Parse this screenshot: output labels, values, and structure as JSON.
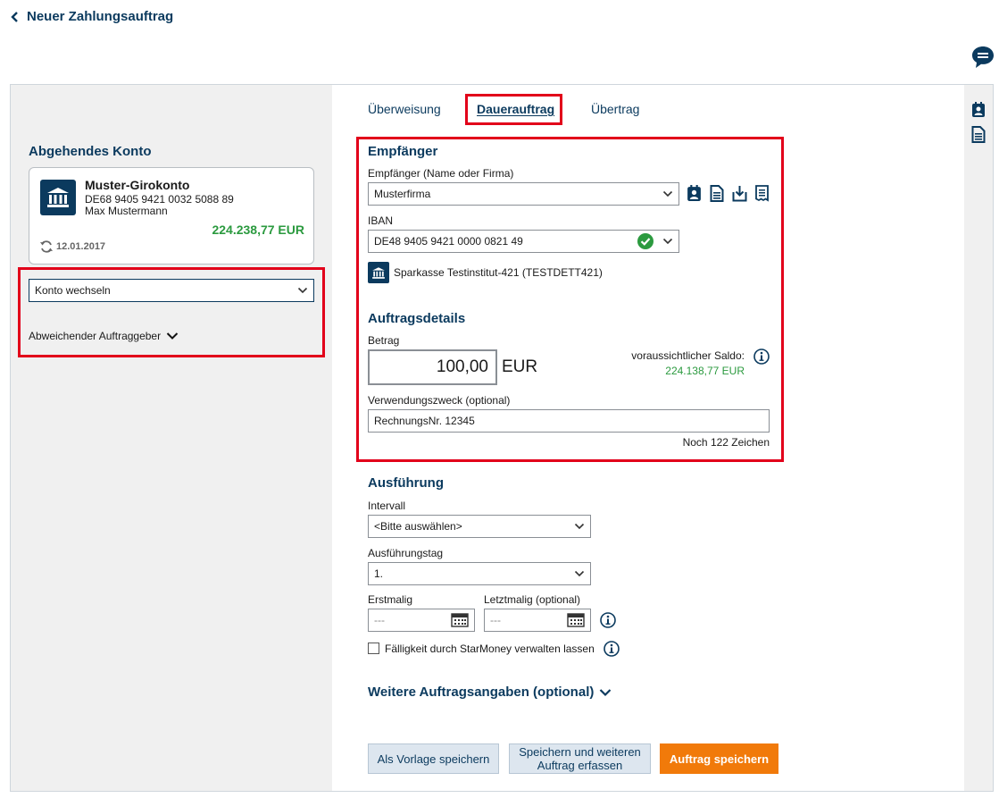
{
  "header": {
    "title": "Neuer Zahlungsauftrag"
  },
  "tabs": [
    {
      "label": "Überweisung"
    },
    {
      "label": "Dauerauftrag"
    },
    {
      "label": "Übertrag"
    }
  ],
  "source_account": {
    "heading": "Abgehendes Konto",
    "name": "Muster-Girokonto",
    "iban": "DE68 9405 9421 0032 5088 89",
    "owner": "Max Mustermann",
    "balance": "224.238,77 EUR",
    "updated": "12.01.2017",
    "switch_label": "Konto wechseln",
    "different_payer_label": "Abweichender Auftraggeber"
  },
  "recipient": {
    "heading": "Empfänger",
    "name_label": "Empfänger (Name oder Firma)",
    "name_value": "Musterfirma",
    "iban_label": "IBAN",
    "iban_value": "DE48 9405 9421 0000 0821 49",
    "bank_name": "Sparkasse Testinstitut-421",
    "bic": "(TESTDETT421)"
  },
  "order_details": {
    "heading": "Auftragsdetails",
    "amount_label": "Betrag",
    "amount_value": "100,00",
    "currency": "EUR",
    "projected_balance_label": "voraussichtlicher Saldo:",
    "projected_balance_value": "224.138,77 EUR",
    "purpose_label": "Verwendungszweck (optional)",
    "purpose_value": "RechnungsNr. 12345",
    "chars_left": "Noch 122 Zeichen"
  },
  "execution": {
    "heading": "Ausführung",
    "interval_label": "Intervall",
    "interval_value": "<Bitte auswählen>",
    "day_label": "Ausführungstag",
    "day_value": "1.",
    "first_label": "Erstmalig",
    "first_value": "---",
    "last_label": "Letztmalig (optional)",
    "last_value": "---",
    "starmoney_label": "Fälligkeit durch StarMoney verwalten lassen"
  },
  "more_details_label": "Weitere Auftragsangaben (optional)",
  "buttons": {
    "save_template": "Als Vorlage speichern",
    "save_and_next_line1": "Speichern und weiteren",
    "save_and_next_line2": "Auftrag erfassen",
    "save_order": "Auftrag speichern"
  },
  "colors": {
    "navy": "#0b3a5e",
    "accent_orange": "#f17a0a",
    "success_green": "#2b9a3f",
    "highlight_red": "#e2001a"
  },
  "icons": [
    "chevron-left-icon",
    "chat-icon",
    "bank-icon",
    "refresh-icon",
    "chevron-down-icon",
    "address-book-icon",
    "document-icon",
    "download-icon",
    "receipt-icon",
    "check-circle-icon",
    "info-icon",
    "calendar-icon"
  ]
}
